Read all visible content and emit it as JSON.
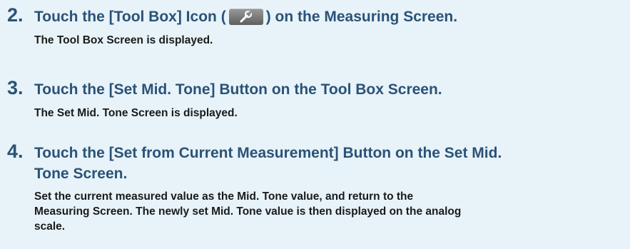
{
  "steps": [
    {
      "number": "2.",
      "title_before": "Touch the [Tool Box] Icon (",
      "icon": "wrench-icon",
      "title_after": ") on the Measuring Screen.",
      "body": "The Tool Box Screen is displayed."
    },
    {
      "number": "3.",
      "title": "Touch the [Set Mid. Tone] Button on the Tool Box Screen.",
      "body": "The Set Mid. Tone Screen is displayed."
    },
    {
      "number": "4.",
      "title_line1": "Touch the [Set from Current Measurement] Button on the Set Mid.",
      "title_line2": "Tone Screen.",
      "body_line1": "Set the current measured value as the Mid. Tone value, and return to the",
      "body_line2": "Measuring Screen. The newly set Mid. Tone value is then displayed on the analog",
      "body_line3": "scale."
    }
  ],
  "colors": {
    "background": "#e7f3f9",
    "heading": "#2b5277",
    "body_text": "#1a1a1a"
  }
}
